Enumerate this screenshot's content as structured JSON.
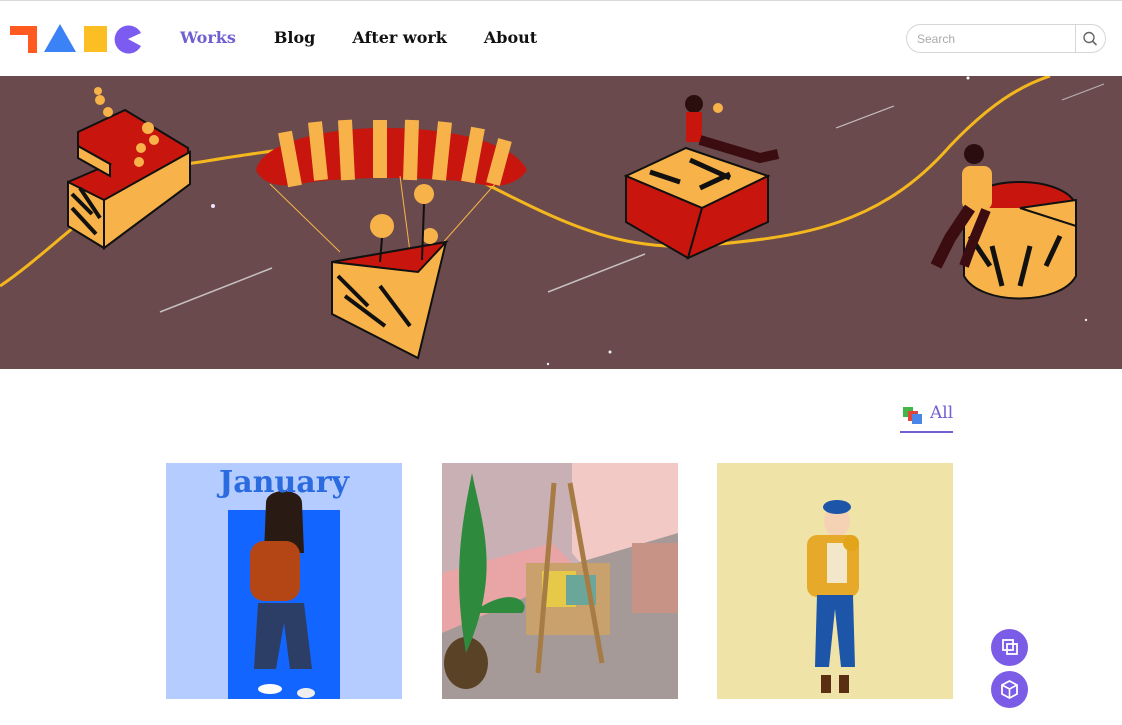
{
  "header": {
    "logo": {
      "name": "logo",
      "colors": [
        "#ff5a1f",
        "#3b82f6",
        "#fbbf24",
        "#7c5cf0"
      ]
    },
    "nav": [
      {
        "label": "Works",
        "active": true
      },
      {
        "label": "Blog",
        "active": false
      },
      {
        "label": "After work",
        "active": false
      },
      {
        "label": "About",
        "active": false
      }
    ],
    "search": {
      "placeholder": "Search",
      "value": "",
      "icon": "search-icon"
    }
  },
  "filter": {
    "label": "All",
    "icon": "stack-icon"
  },
  "gallery": [
    {
      "title": "January",
      "kind": "illustration-girl-january"
    },
    {
      "title": "",
      "kind": "illustration-easel-studio"
    },
    {
      "title": "",
      "kind": "illustration-girl-sunflowers"
    }
  ],
  "fabs": [
    {
      "icon": "layers-icon"
    },
    {
      "icon": "cube-icon"
    }
  ],
  "colors": {
    "accent": "#6f5fd1",
    "hero_bg": "#6a4a4c",
    "fab": "#7b5ce6"
  }
}
